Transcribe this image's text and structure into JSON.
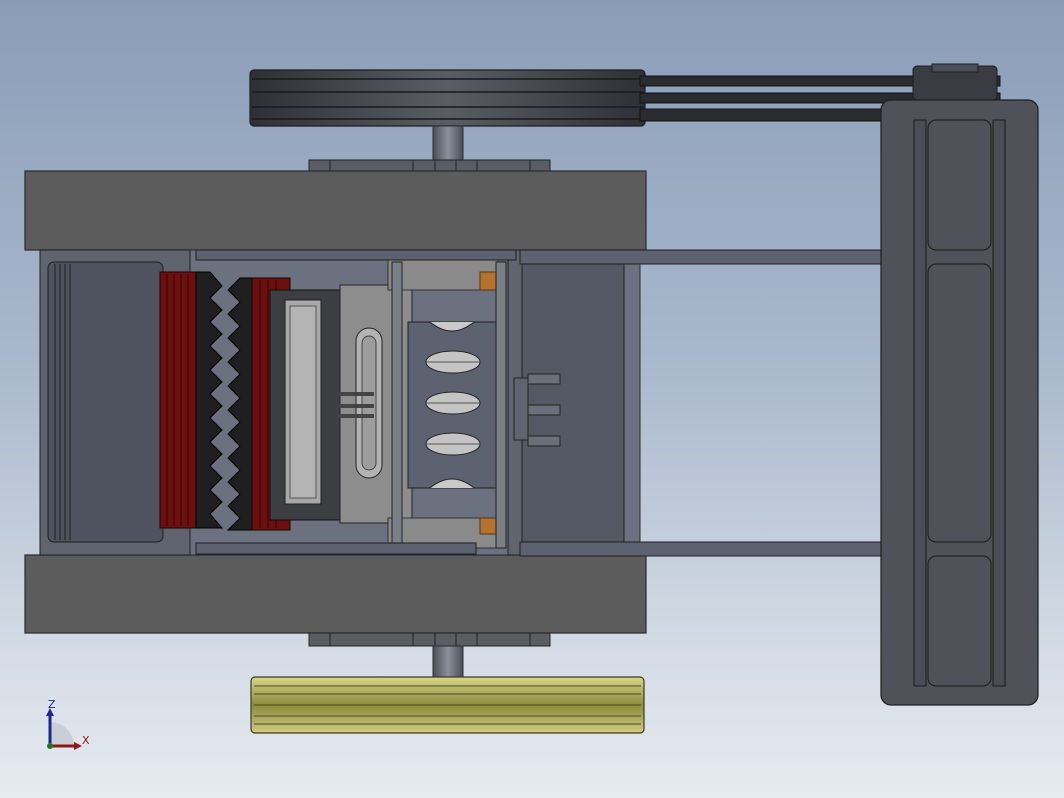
{
  "app": {
    "view": "Top view"
  },
  "colors": {
    "background_top": "#8a9db8",
    "background_bottom": "#e6ebf1",
    "frame": "#5b5b5b",
    "frame_dark": "#4a4c52",
    "steel": "#5f6470",
    "jaw_teeth": "#1f1f1f",
    "jaw_liner": "#6d0f0f",
    "bearing_copper": "#b5722e",
    "pulley_yellow": "#b8b66a",
    "belt": "#2a2a2a"
  },
  "parts": [
    {
      "name": "flywheel-pulley",
      "color": "#3d3f44"
    },
    {
      "name": "v-belts",
      "count": 3
    },
    {
      "name": "motor-pulley"
    },
    {
      "name": "motor-base-frame",
      "color": "#4f5259"
    },
    {
      "name": "side-frame-plates",
      "count": 2
    },
    {
      "name": "fixed-jaw"
    },
    {
      "name": "movable-jaw"
    },
    {
      "name": "eccentric-shaft"
    },
    {
      "name": "toggle-plate"
    },
    {
      "name": "flywheel-yellow",
      "color": "#b8b66a"
    }
  ],
  "triad": {
    "z_label": "Z",
    "x_label": "X"
  }
}
